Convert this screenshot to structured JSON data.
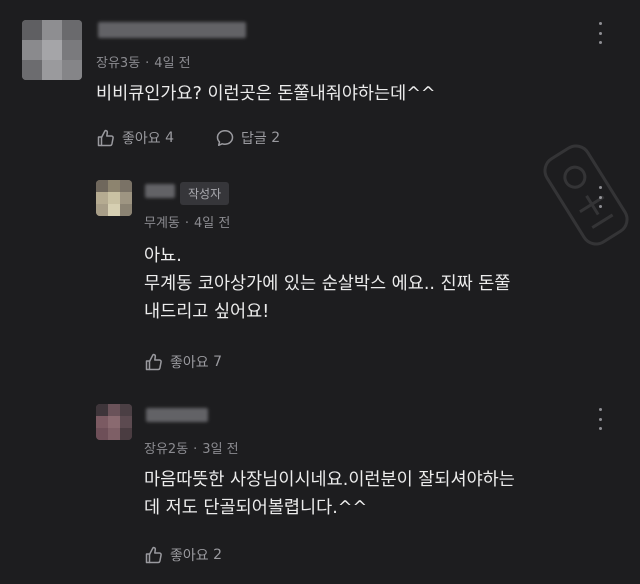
{
  "comments": [
    {
      "meta": {
        "dong": "장유3동",
        "time": "4일 전"
      },
      "text_lines": [
        "비비큐인가요? 이런곳은 돈쭐내줘야하는데^^"
      ],
      "like": {
        "label": "좋아요",
        "count": "4"
      },
      "reply": {
        "label": "답글",
        "count": "2"
      }
    },
    {
      "author_badge": "작성자",
      "meta": {
        "dong": "무계동",
        "time": "4일 전"
      },
      "text_lines": [
        "아뇨.",
        "무계동 코아상가에 있는 순살박스 에요.. 진짜 돈쭐",
        "내드리고 싶어요!"
      ],
      "like": {
        "label": "좋아요",
        "count": "7"
      }
    },
    {
      "meta": {
        "dong": "장유2동",
        "time": "3일 전"
      },
      "text_lines": [
        "마음따뜻한 사장님이시네요.이런분이 잘되셔야하는",
        "데 저도 단골되어볼렵니다.^^"
      ],
      "like": {
        "label": "좋아요",
        "count": "2"
      }
    }
  ],
  "separator": "·",
  "colors": {
    "background": "#1d1d1f",
    "text": "#ececec",
    "meta": "#8b8b90",
    "action": "#9a9a9f",
    "badge_bg": "#36363a"
  },
  "icons": [
    "thumbs-up-icon",
    "speech-bubble-icon",
    "more-vert-icon"
  ]
}
